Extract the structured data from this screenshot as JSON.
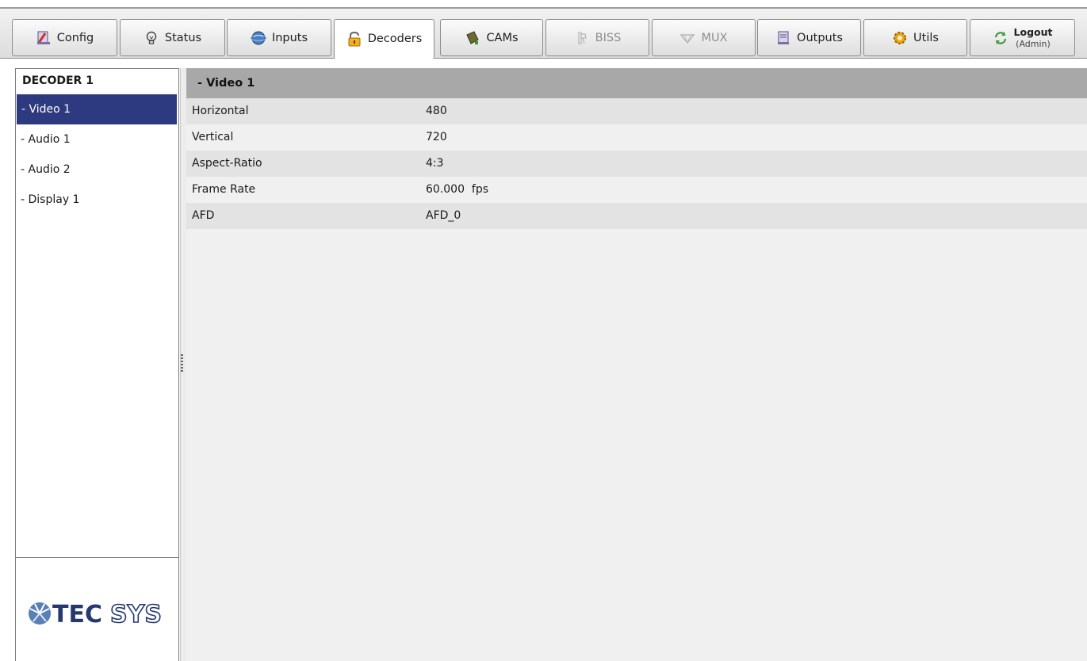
{
  "tabs": [
    {
      "label": "Config",
      "icon": "config-icon"
    },
    {
      "label": "Status",
      "icon": "bulb-icon"
    },
    {
      "label": "Inputs",
      "icon": "globe-icon"
    },
    {
      "label": "Decoders",
      "icon": "lock-icon",
      "active": true
    },
    {
      "label": "CAMs",
      "icon": "cam-card-icon"
    },
    {
      "label": "BISS",
      "icon": "biss-icon",
      "disabled": true
    },
    {
      "label": "MUX",
      "icon": "mux-icon",
      "disabled": true
    },
    {
      "label": "Outputs",
      "icon": "outputs-icon"
    },
    {
      "label": "Utils",
      "icon": "gear-icon"
    }
  ],
  "logout": {
    "label": "Logout",
    "user": "(Admin)",
    "icon": "refresh-icon"
  },
  "sidebar": {
    "header": "DECODER 1",
    "items": [
      {
        "label": "- Video 1",
        "selected": true
      },
      {
        "label": "- Audio 1"
      },
      {
        "label": "- Audio 2"
      },
      {
        "label": "- Display 1"
      }
    ]
  },
  "logo": {
    "text": "TECSYS"
  },
  "section": {
    "title": "- Video 1",
    "rows": [
      {
        "key": "Horizontal",
        "value": "480"
      },
      {
        "key": "Vertical",
        "value": "720"
      },
      {
        "key": "Aspect-Ratio",
        "value": "4:3"
      },
      {
        "key": "Frame Rate",
        "value": "60.000  fps"
      },
      {
        "key": "AFD",
        "value": "AFD_0"
      }
    ]
  },
  "colors": {
    "selected": "#2d3a80",
    "section_header": "#a8a8a8",
    "row_alt": "#e3e3e3",
    "content_bg": "#f0f0f0"
  }
}
